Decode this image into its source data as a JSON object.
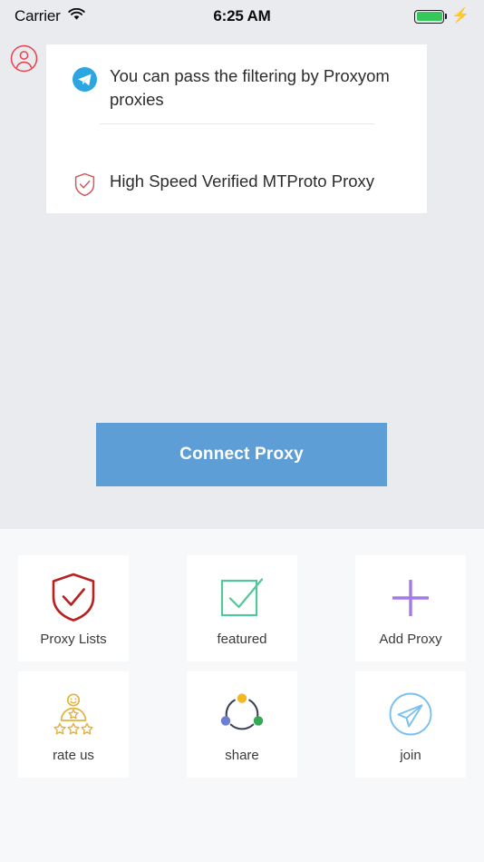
{
  "status_bar": {
    "carrier": "Carrier",
    "wifi_icon": "wifi-icon",
    "time": "6:25 AM",
    "battery_icon": "battery-icon",
    "charging_icon": "lightning-bolt-icon",
    "battery_color": "#35c759"
  },
  "avatar": {
    "icon": "user-circle-icon",
    "color": "#e8414a"
  },
  "info_card": {
    "rows": [
      {
        "icon": "telegram-icon",
        "icon_color": "#2ca5e0",
        "text": "You can pass the filtering by Proxyom proxies"
      },
      {
        "icon": "shield-check-icon",
        "icon_color": "#cf5b5a",
        "text": "High Speed Verified MTProto Proxy"
      }
    ]
  },
  "connect_button": {
    "label": "Connect Proxy",
    "background": "#5e9ed6",
    "text_color": "#ffffff"
  },
  "tiles": [
    {
      "label": "Proxy Lists",
      "icon": "shield-check-icon",
      "color": "#b7221f"
    },
    {
      "label": "featured",
      "icon": "checkbox-check-icon",
      "color": "#54c79a"
    },
    {
      "label": "Add Proxy",
      "icon": "plus-icon",
      "color": "#a47ae8"
    },
    {
      "label": "rate us",
      "icon": "person-stars-icon",
      "color": "#e2b23c"
    },
    {
      "label": "share",
      "icon": "share-nodes-icon",
      "color": "#4a4f63"
    },
    {
      "label": "join",
      "icon": "send-circle-icon",
      "color": "#7cc0ec"
    }
  ],
  "share_icon_colors": {
    "top_dot": "#f0b823",
    "left_dot": "#6d7fd0",
    "right_dot": "#34a853",
    "arc": "#3c4257"
  },
  "theme": {
    "background_top": "#eaebef",
    "background_bottom": "#f7f8fa",
    "card_background": "#ffffff"
  }
}
